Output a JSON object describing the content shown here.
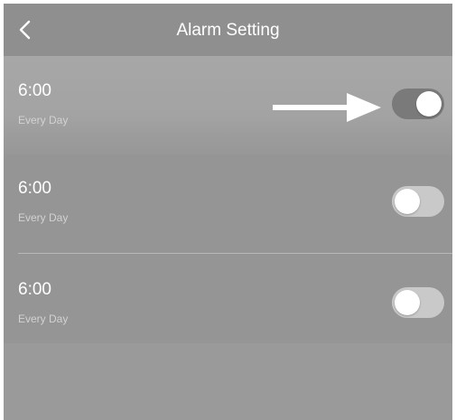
{
  "header": {
    "title": "Alarm Setting",
    "back_icon": "chevron-left-icon"
  },
  "alarms": [
    {
      "time": "6:00",
      "repeat": "Every Day",
      "enabled": true
    },
    {
      "time": "6:00",
      "repeat": "Every Day",
      "enabled": false
    },
    {
      "time": "6:00",
      "repeat": "Every Day",
      "enabled": false
    }
  ],
  "annotation": {
    "icon": "arrow-right-icon",
    "color": "#ffffff"
  },
  "colors": {
    "header_bg": "#8f8f8f",
    "toggle_on": "#7a7a7a",
    "toggle_off": "#c9c9c9",
    "text": "#ffffff"
  }
}
